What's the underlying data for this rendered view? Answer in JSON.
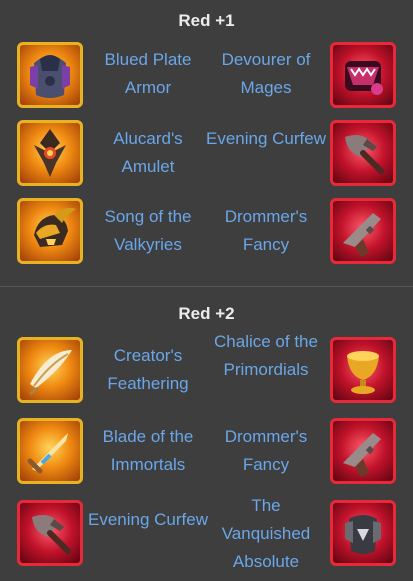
{
  "sections": [
    {
      "title": "Red +1",
      "rows": [
        {
          "left_name": "Blued Plate Armor",
          "right_name": "Devourer of Mages",
          "left_icon": "plate-armor-icon",
          "right_icon": "devourer-icon"
        },
        {
          "left_name": "Alucard's Amulet",
          "right_name": "Evening Curfew",
          "left_icon": "amulet-icon",
          "right_icon": "axe-icon"
        },
        {
          "left_name": "Song of the Valkyries",
          "right_name": "Drommer's Fancy",
          "left_icon": "winged-helm-icon",
          "right_icon": "pistol-icon"
        }
      ]
    },
    {
      "title": "Red +2",
      "rows": [
        {
          "left_name": "Creator's Feathering",
          "right_name": "Chalice of the Primordials",
          "left_icon": "feather-wing-icon",
          "right_icon": "chalice-icon"
        },
        {
          "left_name": "Blade of the Immortals",
          "right_name": "Drommer's Fancy",
          "left_icon": "sword-icon",
          "right_icon": "pistol-icon"
        },
        {
          "left_name": "Evening Curfew",
          "right_name": "The Vanquished Absolute",
          "left_icon": "axe-icon",
          "right_icon": "dark-armor-icon"
        }
      ]
    }
  ],
  "colors": {
    "background": "#3e3e3e",
    "item_name": "#6aa6e8",
    "gold_frame": "#e8b323",
    "red_frame": "#e8293a"
  }
}
